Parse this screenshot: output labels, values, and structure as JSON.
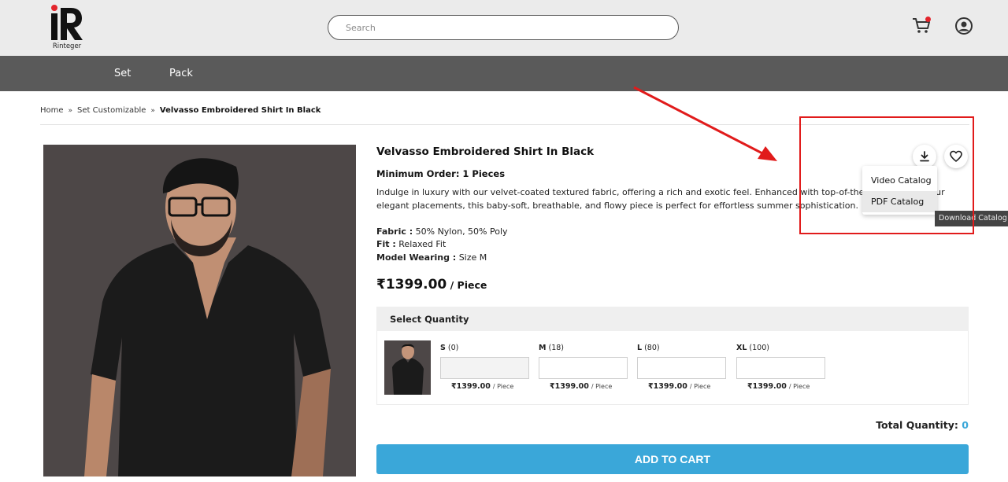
{
  "header": {
    "logo_text": "Rinteger",
    "search_placeholder": "Search",
    "cart_icon": "cart-icon",
    "user_icon": "user-icon"
  },
  "nav": {
    "items": [
      {
        "label": "Set"
      },
      {
        "label": "Pack"
      }
    ]
  },
  "breadcrumb": {
    "items": [
      "Home",
      "Set Customizable"
    ],
    "separator": "»",
    "current": "Velvasso Embroidered Shirt In Black"
  },
  "product": {
    "title": "Velvasso Embroidered Shirt In Black",
    "min_order": "Minimum Order: 1 Pieces",
    "description": "Indulge in luxury with our velvet-coated textured fabric, offering a rich and exotic feel. Enhanced with top-of-the-li",
    "description_tail": "four",
    "description_line2": "elegant placements, this baby-soft, breathable, and flowy piece is perfect for effortless summer sophistication.",
    "fabric_label": "Fabric :",
    "fabric_value": " 50% Nylon, 50% Poly",
    "fit_label": "Fit :",
    "fit_value": " Relaxed Fit",
    "model_label": "Model Wearing :",
    "model_value": " Size M",
    "price": "₹1399.00",
    "price_unit": " / Piece"
  },
  "quantity": {
    "heading": "Select Quantity",
    "sizes": [
      {
        "name": "S",
        "stock": "(0)",
        "price": "₹1399.00",
        "per": "/ Piece",
        "disabled": true
      },
      {
        "name": "M",
        "stock": "(18)",
        "price": "₹1399.00",
        "per": "/ Piece",
        "disabled": false
      },
      {
        "name": "L",
        "stock": "(80)",
        "price": "₹1399.00",
        "per": "/ Piece",
        "disabled": false
      },
      {
        "name": "XL",
        "stock": "(100)",
        "price": "₹1399.00",
        "per": "/ Piece",
        "disabled": false
      }
    ],
    "total_label": "Total Quantity: ",
    "total_value": "0"
  },
  "actions": {
    "add_to_cart": "ADD TO CART",
    "dropdown": [
      "Video Catalog",
      "PDF Catalog"
    ],
    "tooltip": "Download Catalog"
  },
  "colors": {
    "accent": "#3aa7d9",
    "nav_bg": "#5a5a5a",
    "annotation": "#e11b1b"
  }
}
